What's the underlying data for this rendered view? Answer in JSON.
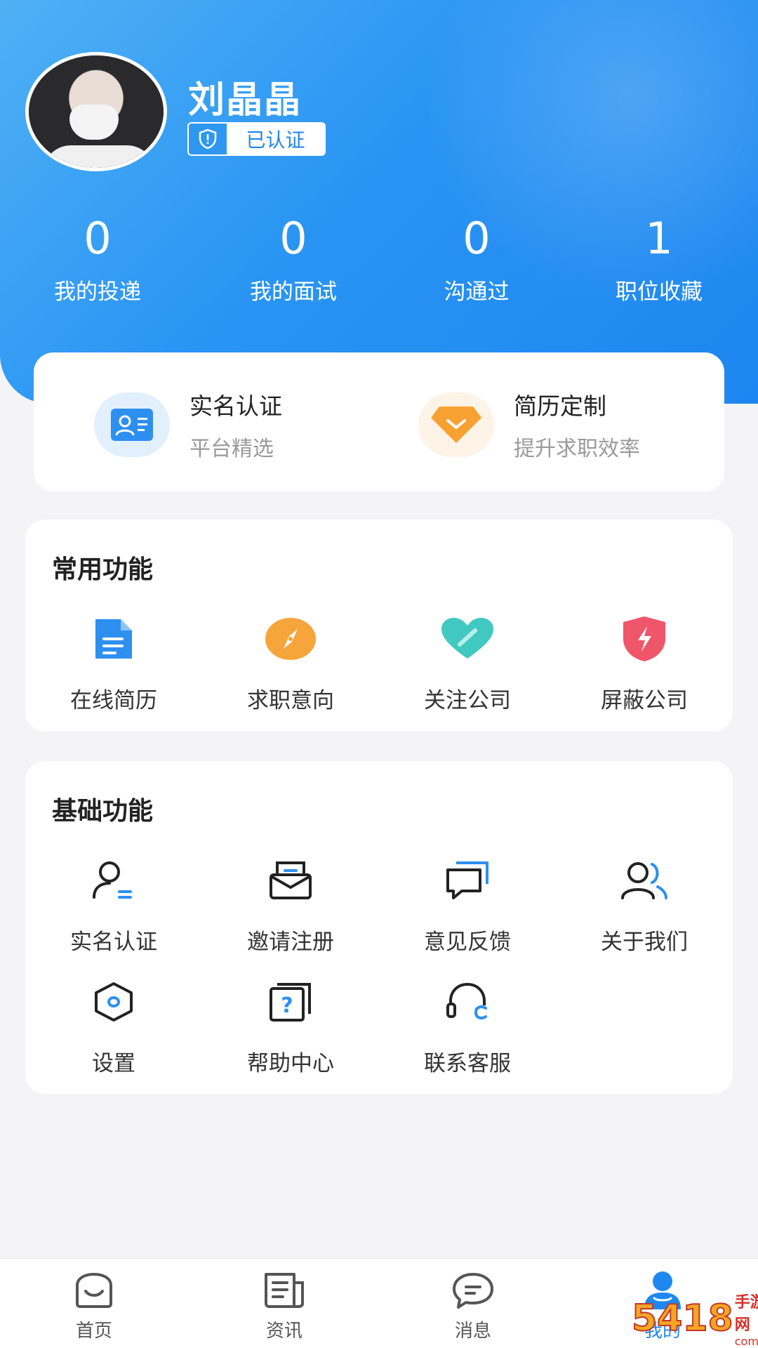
{
  "profile": {
    "name": "刘晶晶",
    "verified_label": "已认证"
  },
  "stats": [
    {
      "value": "0",
      "label": "我的投递"
    },
    {
      "value": "0",
      "label": "我的面试"
    },
    {
      "value": "0",
      "label": "沟通过"
    },
    {
      "value": "1",
      "label": "职位收藏"
    }
  ],
  "promo": [
    {
      "title": "实名认证",
      "subtitle": "平台精选",
      "icon": "id-card-icon"
    },
    {
      "title": "简历定制",
      "subtitle": "提升求职效率",
      "icon": "diamond-icon"
    }
  ],
  "common_functions": {
    "title": "常用功能",
    "items": [
      {
        "label": "在线简历",
        "icon": "document-icon"
      },
      {
        "label": "求职意向",
        "icon": "compass-icon"
      },
      {
        "label": "关注公司",
        "icon": "heart-icon"
      },
      {
        "label": "屏蔽公司",
        "icon": "shield-bolt-icon"
      }
    ]
  },
  "basic_functions": {
    "title": "基础功能",
    "items": [
      {
        "label": "实名认证",
        "icon": "user-verify-icon"
      },
      {
        "label": "邀请注册",
        "icon": "envelope-icon"
      },
      {
        "label": "意见反馈",
        "icon": "chat-feedback-icon"
      },
      {
        "label": "关于我们",
        "icon": "users-icon"
      },
      {
        "label": "设置",
        "icon": "hexagon-settings-icon"
      },
      {
        "label": "帮助中心",
        "icon": "help-icon"
      },
      {
        "label": "联系客服",
        "icon": "headset-icon"
      }
    ]
  },
  "tabbar": {
    "items": [
      {
        "label": "首页",
        "icon": "home-icon"
      },
      {
        "label": "资讯",
        "icon": "news-icon"
      },
      {
        "label": "消息",
        "icon": "message-icon"
      },
      {
        "label": "我的",
        "icon": "profile-icon"
      }
    ],
    "active_index": 3
  },
  "watermark": {
    "number": "5418",
    "text": "手游网",
    "domain": "com.cn"
  },
  "colors": {
    "primary": "#1e88f0",
    "hero_start": "#4fb0f5",
    "hero_end": "#1d86f0",
    "orange": "#f7a132",
    "teal": "#41c9c1",
    "red": "#f0566a"
  }
}
